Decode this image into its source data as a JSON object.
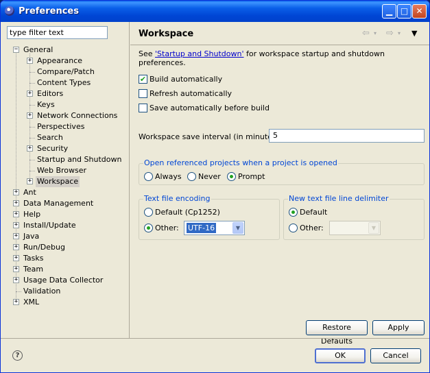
{
  "window": {
    "title": "Preferences"
  },
  "filter": {
    "value": "type filter text"
  },
  "tree": {
    "general": "General",
    "general_children": [
      "Appearance",
      "Compare/Patch",
      "Content Types",
      "Editors",
      "Keys",
      "Network Connections",
      "Perspectives",
      "Search",
      "Security",
      "Startup and Shutdown",
      "Web Browser",
      "Workspace"
    ],
    "top_level": [
      "Ant",
      "Data Management",
      "Help",
      "Install/Update",
      "Java",
      "Run/Debug",
      "Tasks",
      "Team",
      "Usage Data Collector",
      "Validation",
      "XML"
    ],
    "selected": "Workspace"
  },
  "page": {
    "title": "Workspace",
    "intro_prefix": "See ",
    "intro_link": "'Startup and Shutdown'",
    "intro_suffix": " for workspace startup and shutdown preferences.",
    "build_auto": "Build automatically",
    "refresh_auto": "Refresh automatically",
    "save_auto": "Save automatically before build",
    "interval_label": "Workspace save interval (in minutes):",
    "interval_value": "5",
    "open_group": "Open referenced projects when a project is opened",
    "always": "Always",
    "never": "Never",
    "prompt": "Prompt",
    "encoding_group": "Text file encoding",
    "encoding_default": "Default (Cp1252)",
    "encoding_other": "Other:",
    "encoding_value": "UTF-16",
    "delimiter_group": "New text file line delimiter",
    "delim_default": "Default",
    "delim_other": "Other:",
    "restore_defaults": "Restore Defaults",
    "apply": "Apply"
  },
  "footer": {
    "ok": "OK",
    "cancel": "Cancel"
  },
  "state": {
    "build_auto_checked": true,
    "refresh_checked": false,
    "save_checked": false,
    "open_projects": "Prompt",
    "encoding": "Other",
    "delimiter": "Default"
  }
}
